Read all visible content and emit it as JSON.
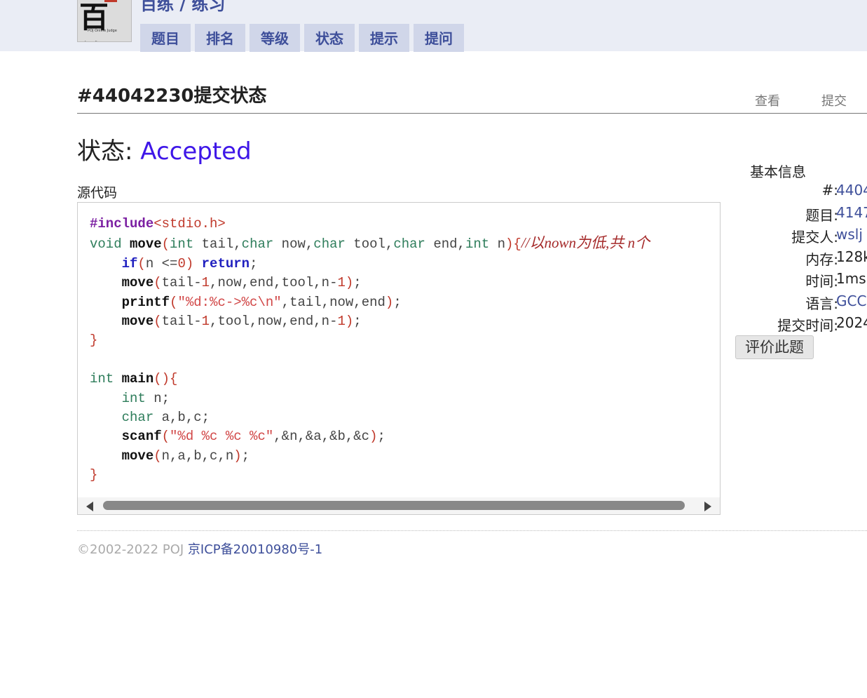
{
  "header": {
    "site_title": "百练 / 练习",
    "logo": {
      "glyph": "百练",
      "small_text": "POJ Online Judge"
    },
    "tabs": [
      "题目",
      "排名",
      "等级",
      "状态",
      "提示",
      "提问"
    ]
  },
  "page": {
    "title": "#44042230提交状态",
    "actions": [
      "查看",
      "提交"
    ],
    "status_label": "状态:",
    "status_value": "Accepted",
    "source_label": "源代码"
  },
  "code_lines": [
    "#include<stdio.h>",
    "void move(int tail,char now,char tool,char end,int n){//以nown为低,共 n个",
    "    if(n <=0) return;",
    "    move(tail-1,now,end,tool,n-1);",
    "    printf(\"%d:%c->%c\\n\",tail,now,end);",
    "    move(tail-1,tool,now,end,n-1);",
    "}",
    "",
    "int main(){",
    "    int n;",
    "    char a,b,c;",
    "    scanf(\"%d %c %c %c\",&n,&a,&b,&c);",
    "    move(n,a,b,c,n);",
    "}"
  ],
  "info": {
    "heading": "基本信息",
    "rows": [
      {
        "label": "#:",
        "value": "4404"
      },
      {
        "label": "题目:",
        "value": "4147"
      },
      {
        "label": "提交人:",
        "value": "wslj"
      },
      {
        "label": "内存:",
        "value": "128k"
      },
      {
        "label": "时间:",
        "value": "1ms"
      },
      {
        "label": "语言:",
        "value": "GCC"
      },
      {
        "label": "提交时间:",
        "value": "2024"
      }
    ],
    "rate_button": "评价此题"
  },
  "footer": {
    "copyright": "©2002-2022 POJ",
    "icp": "京ICP备20010980号-1"
  },
  "colors": {
    "accent": "#3e4f9a",
    "status": "#3e16e8",
    "topbar": "#eaedf5",
    "tab": "#d0d6e9"
  }
}
